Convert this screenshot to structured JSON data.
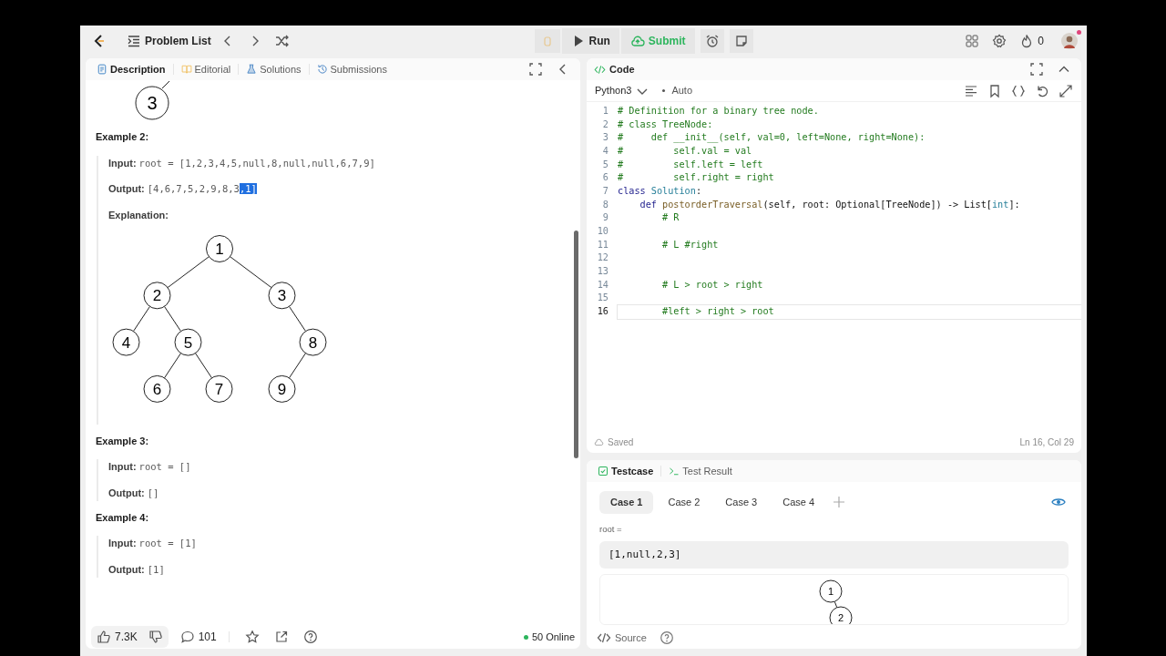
{
  "topbar": {
    "problem_list": "Problem List",
    "run": "Run",
    "submit": "Submit",
    "streak": "0",
    "notification": true
  },
  "description_panel": {
    "tabs": [
      {
        "label": "Description",
        "selected": true
      },
      {
        "label": "Editorial",
        "selected": false
      },
      {
        "label": "Solutions",
        "selected": false
      },
      {
        "label": "Submissions",
        "selected": false
      }
    ],
    "fragment_tree": {
      "value": "3"
    },
    "examples": [
      {
        "title": "Example 2:",
        "input_label": "Input:",
        "input": "root = [1,2,3,4,5,null,8,null,null,6,7,9]",
        "output_label": "Output:",
        "output": "[4,6,7,5,2,9,8,3",
        "output_highlighted": ",1]",
        "explanation_label": "Explanation:",
        "tree": {
          "value": "1",
          "left": {
            "value": "2",
            "left": {
              "value": "4"
            },
            "right": {
              "value": "5",
              "left": {
                "value": "6"
              },
              "right": {
                "value": "7"
              }
            }
          },
          "right": {
            "value": "3",
            "right": {
              "value": "8",
              "left": {
                "value": "9"
              }
            }
          }
        }
      },
      {
        "title": "Example 3:",
        "input_label": "Input:",
        "input": "root = []",
        "output_label": "Output:",
        "output": "[]"
      },
      {
        "title": "Example 4:",
        "input_label": "Input:",
        "input": "root = [1]",
        "output_label": "Output:",
        "output": "[1]"
      }
    ],
    "footer": {
      "likes": "7.3K",
      "comments": "101",
      "online": "50 Online"
    }
  },
  "code_panel": {
    "title": "Code",
    "language": "Python3",
    "mode": "Auto",
    "lines": [
      {
        "number": "1",
        "current": false,
        "tokens": [
          {
            "kind": "comment",
            "text": "# Definition for a binary tree node."
          }
        ]
      },
      {
        "number": "2",
        "current": false,
        "tokens": [
          {
            "kind": "comment",
            "text": "# class TreeNode:"
          }
        ]
      },
      {
        "number": "3",
        "current": false,
        "tokens": [
          {
            "kind": "comment",
            "text": "#     def __init__(self, val=0, left=None, right=None):"
          }
        ]
      },
      {
        "number": "4",
        "current": false,
        "tokens": [
          {
            "kind": "comment",
            "text": "#         self.val = val"
          }
        ]
      },
      {
        "number": "5",
        "current": false,
        "tokens": [
          {
            "kind": "comment",
            "text": "#         self.left = left"
          }
        ]
      },
      {
        "number": "6",
        "current": false,
        "tokens": [
          {
            "kind": "comment",
            "text": "#         self.right = right"
          }
        ]
      },
      {
        "number": "7",
        "current": false,
        "tokens": [
          {
            "kind": "keyword",
            "text": "class"
          },
          {
            "kind": "type",
            "text": " Solution"
          },
          {
            "kind": "plain",
            "text": ":"
          }
        ]
      },
      {
        "number": "8",
        "current": false,
        "tokens": [
          {
            "kind": "keyword",
            "text": "    def"
          },
          {
            "kind": "function",
            "text": " postorderTraversal"
          },
          {
            "kind": "plain",
            "text": "(self, root: Optional[TreeNode]) -> List["
          },
          {
            "kind": "type",
            "text": "int"
          },
          {
            "kind": "plain",
            "text": "]:"
          }
        ]
      },
      {
        "number": "9",
        "current": false,
        "tokens": [
          {
            "kind": "comment",
            "text": "        # R"
          }
        ]
      },
      {
        "number": "10",
        "current": false
      },
      {
        "number": "11",
        "current": false,
        "tokens": [
          {
            "kind": "comment",
            "text": "        # L #right"
          }
        ]
      },
      {
        "number": "12",
        "current": false
      },
      {
        "number": "13",
        "current": false
      },
      {
        "number": "14",
        "current": false,
        "tokens": [
          {
            "kind": "comment",
            "text": "        # L > root > right"
          }
        ]
      },
      {
        "number": "15",
        "current": false
      },
      {
        "number": "16",
        "current": true,
        "tokens": [
          {
            "kind": "comment",
            "text": "        #left > right > root"
          }
        ]
      }
    ],
    "status": "Saved",
    "position": "Ln 16, Col 29"
  },
  "testcase_panel": {
    "tabs": [
      {
        "label": "Testcase",
        "selected": true
      },
      {
        "label": "Test Result",
        "selected": false
      }
    ],
    "cases": [
      {
        "label": "Case 1",
        "selected": true
      },
      {
        "label": "Case 2",
        "selected": false
      },
      {
        "label": "Case 3",
        "selected": false
      },
      {
        "label": "Case 4",
        "selected": false
      }
    ],
    "param_label": "root =",
    "param_value": "[1,null,2,3]",
    "tree": {
      "value": "1",
      "right": {
        "value": "2"
      }
    },
    "source": "Source"
  }
}
